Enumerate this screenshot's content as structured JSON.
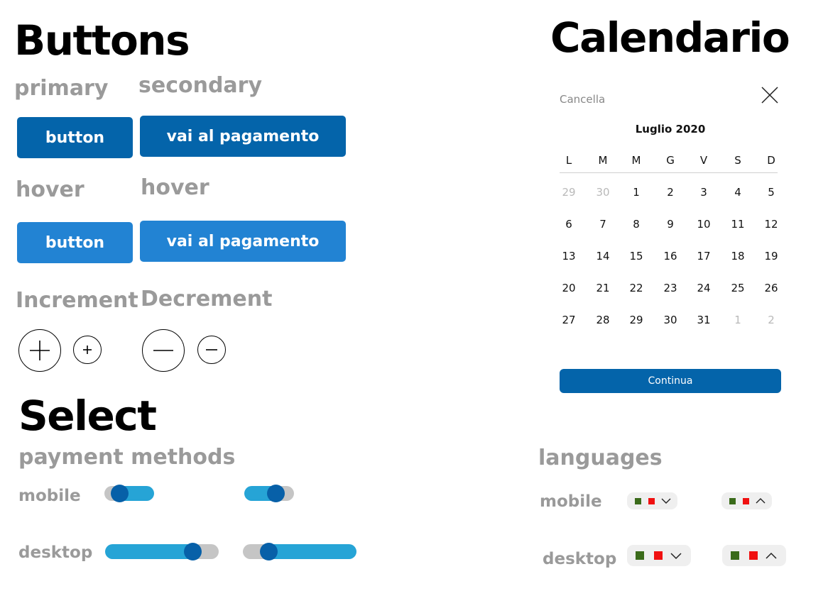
{
  "buttons_section": {
    "title": "Buttons",
    "primary_label": "primary",
    "secondary_label": "secondary",
    "hover_label_1": "hover",
    "hover_label_2": "hover",
    "primary_button": "button",
    "secondary_button": "vai al pagamento",
    "primary_hover_button": "button",
    "secondary_hover_button": "vai al pagamento",
    "increment_label": "Increment",
    "decrement_label": "Decrement",
    "colors": {
      "normal": "#0464aa",
      "hover": "#2283d3"
    },
    "icons": [
      "plus-icon",
      "minus-icon"
    ]
  },
  "calendar": {
    "title": "Calendario",
    "cancel_label": "Cancella",
    "close_icon": "close-icon",
    "month_label": "Luglio 2020",
    "weekdays": [
      "L",
      "M",
      "M",
      "G",
      "V",
      "S",
      "D"
    ],
    "weeks": [
      [
        {
          "d": "29",
          "muted": true
        },
        {
          "d": "30",
          "muted": true
        },
        {
          "d": "1"
        },
        {
          "d": "2"
        },
        {
          "d": "3"
        },
        {
          "d": "4"
        },
        {
          "d": "5"
        }
      ],
      [
        {
          "d": "6"
        },
        {
          "d": "7"
        },
        {
          "d": "8"
        },
        {
          "d": "9"
        },
        {
          "d": "10"
        },
        {
          "d": "11"
        },
        {
          "d": "12"
        }
      ],
      [
        {
          "d": "13"
        },
        {
          "d": "14"
        },
        {
          "d": "15"
        },
        {
          "d": "16"
        },
        {
          "d": "17"
        },
        {
          "d": "18"
        },
        {
          "d": "19"
        }
      ],
      [
        {
          "d": "20"
        },
        {
          "d": "21"
        },
        {
          "d": "22"
        },
        {
          "d": "23"
        },
        {
          "d": "24"
        },
        {
          "d": "25"
        },
        {
          "d": "26"
        }
      ],
      [
        {
          "d": "27"
        },
        {
          "d": "28"
        },
        {
          "d": "29"
        },
        {
          "d": "30"
        },
        {
          "d": "31"
        },
        {
          "d": "1",
          "muted": true
        },
        {
          "d": "2",
          "muted": true
        }
      ]
    ],
    "continue_label": "Continua"
  },
  "select_section": {
    "title": "Select",
    "payment_methods_label": "payment methods",
    "mobile_label": "mobile",
    "desktop_label": "desktop",
    "toggle_colors": {
      "on": "#26a4d6",
      "off": "#c5c5c5",
      "knob": "#0760a8"
    }
  },
  "languages_section": {
    "title": "languages",
    "mobile_label": "mobile",
    "desktop_label": "desktop",
    "flag_colors": {
      "green": "#3a6b1a",
      "red": "#f01010"
    },
    "icons": [
      "chevron-down-icon",
      "chevron-up-icon"
    ]
  }
}
